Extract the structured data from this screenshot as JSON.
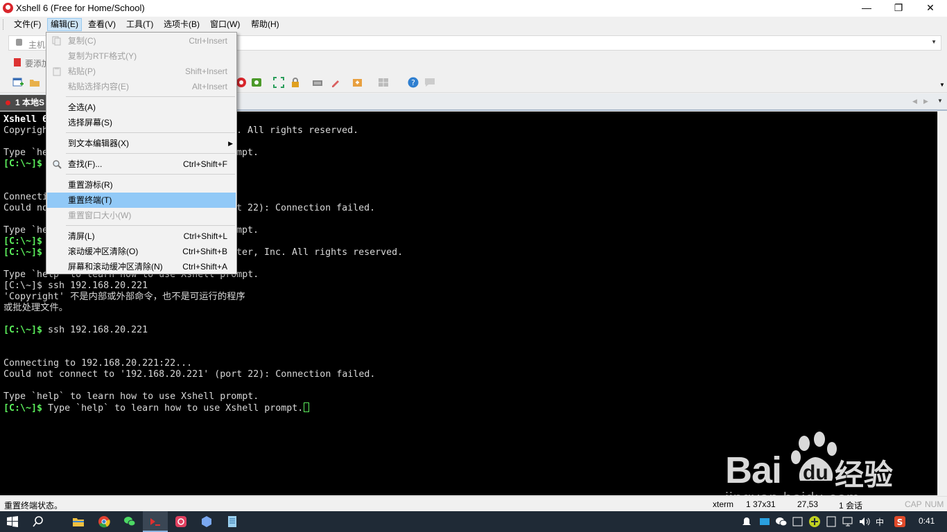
{
  "window": {
    "title": "Xshell 6 (Free for Home/School)",
    "minimize_glyph": "—",
    "maximize_glyph": "❐",
    "close_glyph": "✕"
  },
  "menubar": {
    "items": [
      {
        "label": "文件(F)"
      },
      {
        "label": "编辑(E)"
      },
      {
        "label": "查看(V)"
      },
      {
        "label": "工具(T)"
      },
      {
        "label": "选项卡(B)"
      },
      {
        "label": "窗口(W)"
      },
      {
        "label": "帮助(H)"
      }
    ]
  },
  "address": {
    "text": "主机",
    "add_text": "要添加"
  },
  "tabs": [
    {
      "label": "1 本地S"
    }
  ],
  "edit_menu": {
    "items": [
      {
        "label": "复制(C)",
        "shortcut": "Ctrl+Insert",
        "disabled": true
      },
      {
        "label": "复制为RTF格式(Y)",
        "shortcut": "",
        "disabled": true
      },
      {
        "label": "粘贴(P)",
        "shortcut": "Shift+Insert",
        "disabled": true
      },
      {
        "label": "粘贴选择内容(E)",
        "shortcut": "Alt+Insert",
        "disabled": true
      },
      {
        "label": "全选(A)",
        "shortcut": ""
      },
      {
        "label": "选择屏幕(S)",
        "shortcut": ""
      },
      {
        "label": "到文本编辑器(X)",
        "shortcut": "",
        "submenu_arrow": "▶"
      },
      {
        "label": "查找(F)...",
        "shortcut": "Ctrl+Shift+F"
      },
      {
        "label": "重置游标(R)",
        "shortcut": ""
      },
      {
        "label": "重置终端(T)",
        "shortcut": "",
        "highlighted": true
      },
      {
        "label": "重置窗口大小(W)",
        "shortcut": "",
        "disabled": true
      },
      {
        "label": "清屏(L)",
        "shortcut": "Ctrl+Shift+L"
      },
      {
        "label": "滚动缓冲区清除(O)",
        "shortcut": "Ctrl+Shift+B"
      },
      {
        "label": "屏幕和滚动缓冲区清除(N)",
        "shortcut": "Ctrl+Shift+A"
      }
    ]
  },
  "terminal": {
    "lines": [
      {
        "text": "Xshell 6",
        "bold": true
      },
      {
        "text": "Copyrigh"
      },
      {
        "text": ". All rights reserved."
      },
      {
        "text": "Type `he"
      },
      {
        "text": "mpt."
      },
      {
        "prompt": "[C:\\~]$",
        "text": ""
      },
      {
        "text": "Connecti"
      },
      {
        "text": "Could no"
      },
      {
        "text": "t 22): Connection failed."
      },
      {
        "text": "Type `he"
      },
      {
        "text": "mpt."
      },
      {
        "prompt": "[C:\\~]$",
        "text": ""
      },
      {
        "prompt": "[C:\\~]$",
        "text": ""
      },
      {
        "text": "ter, Inc. All rights reserved."
      },
      {
        "text": "Type `help` to learn how to use Xshell prompt."
      },
      {
        "text": "[C:\\~]$ ssh 192.168.20.221"
      },
      {
        "text": "'Copyright' 不是内部或外部命令，也不是可运行的程序"
      },
      {
        "text": "或批处理文件。"
      },
      {
        "prompt": "[C:\\~]$",
        "text": " ssh 192.168.20.221"
      },
      {
        "text": "Connecting to 192.168.20.221:22..."
      },
      {
        "text": "Could not connect to '192.168.20.221' (port 22): Connection failed."
      },
      {
        "text": "Type `help` to learn how to use Xshell prompt."
      },
      {
        "prompt": "[C:\\~]$",
        "text": " Type `help` to learn how to use Xshell prompt."
      }
    ]
  },
  "watermark": {
    "bai": "Bai",
    "du": "du",
    "jingyan": "经验",
    "url": "jingyan.baidu.com"
  },
  "statusbar": {
    "message": "重置终端状态。",
    "term": "xterm",
    "size": "1 37x31",
    "pos": "27,53",
    "sessions": "1 会话",
    "cap": "CAP",
    "num": "NUM"
  },
  "taskbar": {
    "ime": "中",
    "clock": "0:41"
  },
  "colors": {
    "prompt_green": "#5cf05c",
    "menu_highlight": "#91c9f7",
    "tab_bg": "#4a4a4a"
  }
}
